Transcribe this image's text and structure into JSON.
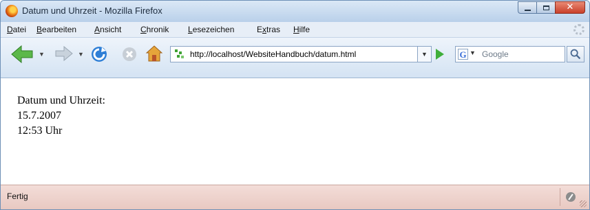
{
  "window": {
    "title": "Datum und Uhrzeit - Mozilla Firefox",
    "buttons": {
      "minimize": "minimize-icon",
      "maximize": "maximize-icon",
      "close": "close-icon"
    }
  },
  "menu": [
    {
      "label": "Datei",
      "accel": "D",
      "rest": "atei"
    },
    {
      "label": "Bearbeiten",
      "accel": "B",
      "rest": "earbeiten"
    },
    {
      "label": "Ansicht",
      "accel": "A",
      "rest": "nsicht"
    },
    {
      "label": "Chronik",
      "accel": "C",
      "rest": "hronik"
    },
    {
      "label": "Lesezeichen",
      "accel": "L",
      "rest": "esezeichen"
    },
    {
      "label": "Extras",
      "pre": "E",
      "accel": "x",
      "rest": "tras"
    },
    {
      "label": "Hilfe",
      "accel": "H",
      "rest": "ilfe"
    }
  ],
  "toolbar": {
    "url": "http://localhost/WebsiteHandbuch/datum.html",
    "search_placeholder": "Google",
    "search_engine_letter": "G",
    "icons": [
      "back-icon",
      "forward-icon",
      "reload-icon",
      "stop-icon",
      "home-icon",
      "go-icon",
      "search-icon"
    ]
  },
  "page": {
    "heading": "Datum und Uhrzeit:",
    "date": "15.7.2007",
    "time": "12:53 Uhr"
  },
  "status": {
    "text": "Fertig"
  },
  "colors": {
    "close_button": "#c9402a",
    "status_bar": "#f3ddd8",
    "go_arrow": "#3fae3a"
  }
}
